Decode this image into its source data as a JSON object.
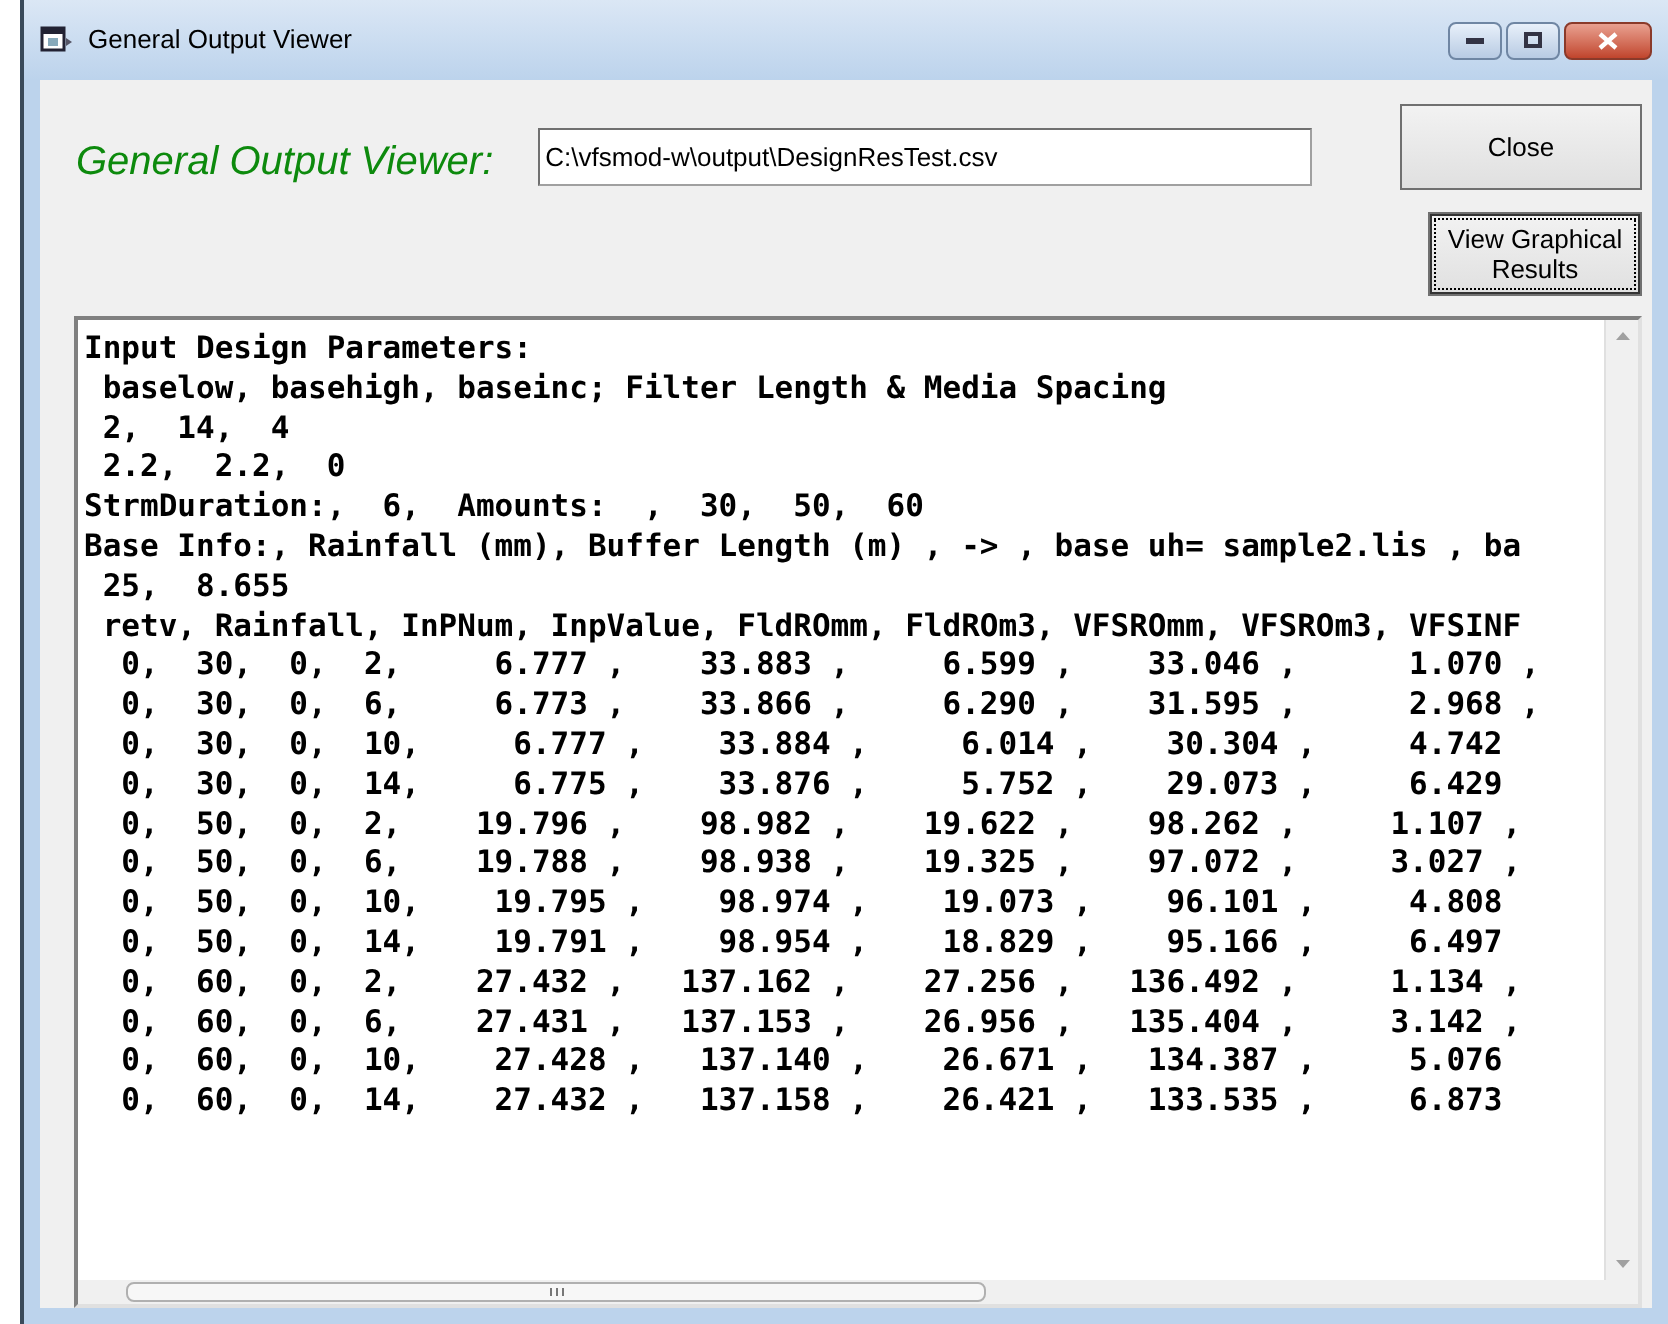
{
  "window": {
    "title": "General Output Viewer"
  },
  "header": {
    "label": "General Output Viewer:",
    "file_path": "C:\\vfsmod-w\\output\\DesignResTest.csv"
  },
  "buttons": [
    {
      "kind": "close",
      "label": "Close",
      "focused": false
    },
    {
      "kind": "graph",
      "label": "View Graphical Results",
      "focused": true
    }
  ],
  "output_lines": [
    "Input Design Parameters:",
    " baselow, basehigh, baseinc; Filter Length & Media Spacing",
    " 2,  14,  4",
    " 2.2,  2.2,  0",
    "StrmDuration:,  6,  Amounts:  ,  30,  50,  60",
    "Base Info:, Rainfall (mm), Buffer Length (m) , -> , base uh= sample2.lis , ba",
    " 25,  8.655",
    " retv, Rainfall, InPNum, InpValue, FldROmm, FldROm3, VFSROmm, VFSROm3, VFSINF",
    "  0,  30,  0,  2,     6.777 ,    33.883 ,     6.599 ,    33.046 ,      1.070 ,",
    "  0,  30,  0,  6,     6.773 ,    33.866 ,     6.290 ,    31.595 ,      2.968 ,",
    "  0,  30,  0,  10,     6.777 ,    33.884 ,     6.014 ,    30.304 ,     4.742",
    "  0,  30,  0,  14,     6.775 ,    33.876 ,     5.752 ,    29.073 ,     6.429",
    "  0,  50,  0,  2,    19.796 ,    98.982 ,    19.622 ,    98.262 ,     1.107 ,",
    "  0,  50,  0,  6,    19.788 ,    98.938 ,    19.325 ,    97.072 ,     3.027 ,",
    "  0,  50,  0,  10,    19.795 ,    98.974 ,    19.073 ,    96.101 ,     4.808",
    "  0,  50,  0,  14,    19.791 ,    98.954 ,    18.829 ,    95.166 ,     6.497",
    "  0,  60,  0,  2,    27.432 ,   137.162 ,    27.256 ,   136.492 ,     1.134 ,",
    "  0,  60,  0,  6,    27.431 ,   137.153 ,    26.956 ,   135.404 ,     3.142 ,",
    "  0,  60,  0,  10,    27.428 ,   137.140 ,    26.671 ,   134.387 ,     5.076",
    "  0,  60,  0,  14,    27.432 ,   137.158 ,    26.421 ,   133.535 ,     6.873"
  ]
}
